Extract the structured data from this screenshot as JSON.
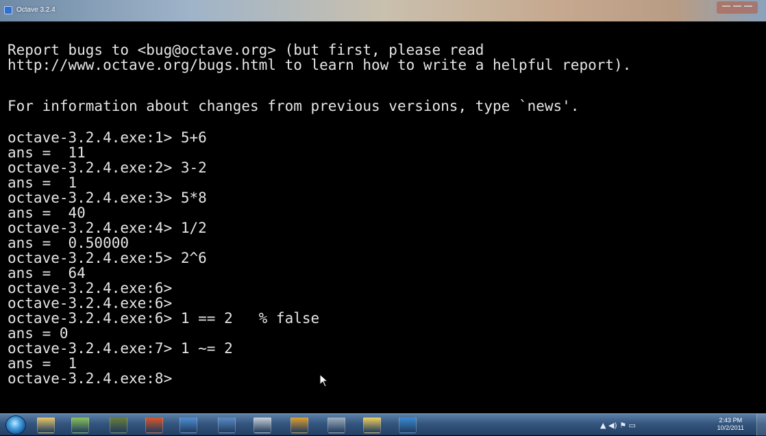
{
  "window": {
    "title": "Octave 3.2.4"
  },
  "console": {
    "lines": [
      "Report bugs to <bug@octave.org> (but first, please read",
      "http://www.octave.org/bugs.html to learn how to write a helpful report).",
      "",
      "For information about changes from previous versions, type `news'.",
      "",
      "octave-3.2.4.exe:1> 5+6",
      "ans =  11",
      "octave-3.2.4.exe:2> 3-2",
      "ans =  1",
      "octave-3.2.4.exe:3> 5*8",
      "ans =  40",
      "octave-3.2.4.exe:4> 1/2",
      "ans =  0.50000",
      "octave-3.2.4.exe:5> 2^6",
      "ans =  64",
      "octave-3.2.4.exe:6>",
      "octave-3.2.4.exe:6>",
      "octave-3.2.4.exe:6> 1 == 2   % false",
      "ans = 0",
      "octave-3.2.4.exe:7> 1 ~= 2",
      "ans =  1",
      "octave-3.2.4.exe:8>"
    ]
  },
  "taskbar": {
    "items": [
      {
        "icon": "start-orb"
      },
      {
        "icon": "explorer-icon",
        "color": "#e8c86a"
      },
      {
        "icon": "notes-icon",
        "color": "#8cc35a"
      },
      {
        "icon": "app-icon",
        "color": "#6b7f3a"
      },
      {
        "icon": "powerpoint-icon",
        "color": "#d9572b"
      },
      {
        "icon": "network-icon",
        "color": "#4f8fd6"
      },
      {
        "icon": "user-icon",
        "color": "#5a8cc8"
      },
      {
        "icon": "printer-icon",
        "color": "#c9d1d9"
      },
      {
        "icon": "chrome-icon",
        "color": "#e0a030"
      },
      {
        "icon": "disc-icon",
        "color": "#9fb0c0"
      },
      {
        "icon": "python-icon",
        "color": "#f0d060"
      },
      {
        "icon": "octave-icon",
        "color": "#3a8ad6"
      }
    ],
    "clock_time": "2:43 PM",
    "clock_date": "10/2/2011"
  }
}
